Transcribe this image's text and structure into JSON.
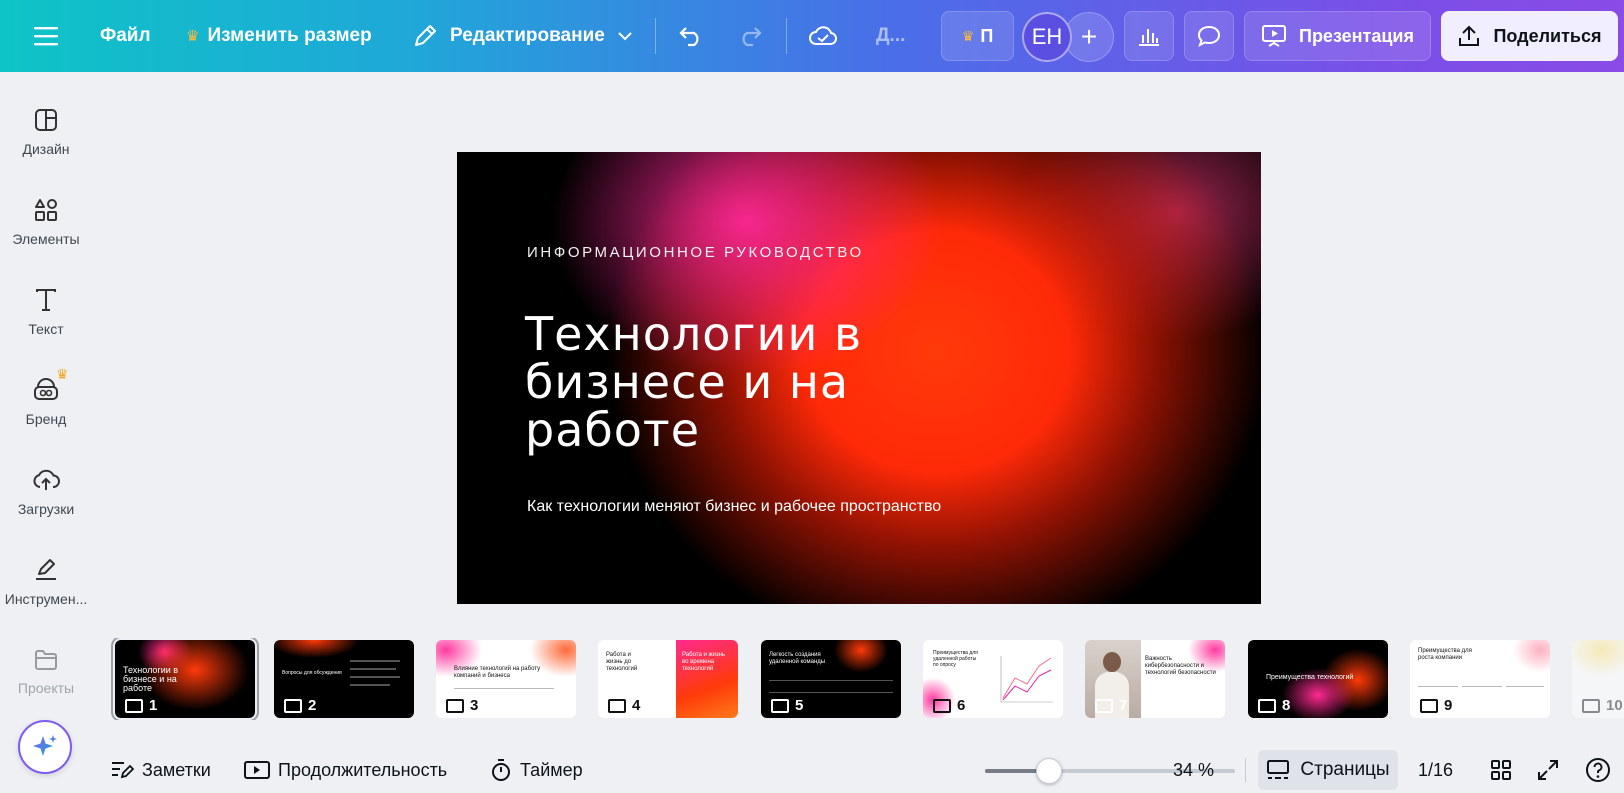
{
  "topbar": {
    "file": "Файл",
    "resize": "Изменить размер",
    "edit_mode": "Редактирование",
    "title_trunc": "Д...",
    "pro_letter": "П",
    "avatar_initials": "ЕН",
    "present": "Презентация",
    "share": "Поделиться",
    "accent_gradient": [
      "#0ec4c6",
      "#4a6ee8",
      "#8a4be6"
    ]
  },
  "sidebar": {
    "items": [
      {
        "label": "Дизайн",
        "icon": "layout-icon"
      },
      {
        "label": "Элементы",
        "icon": "shapes-icon"
      },
      {
        "label": "Текст",
        "icon": "text-icon"
      },
      {
        "label": "Бренд",
        "icon": "brand-icon"
      },
      {
        "label": "Загрузки",
        "icon": "upload-cloud-icon"
      },
      {
        "label": "Инструмен...",
        "icon": "pen-tool-icon"
      },
      {
        "label": "Проекты",
        "icon": "folder-icon"
      }
    ]
  },
  "slide": {
    "overline": "ИНФОРМАЦИОННОЕ РУКОВОДСТВО",
    "title_line1": "Технологии в",
    "title_line2": "бизнесе и на",
    "title_line3": "работе",
    "subtitle": "Как технологии меняют бизнес и рабочее пространство"
  },
  "thumbnails": [
    {
      "num": "1",
      "title": "Технологии в бизнесе и на работе"
    },
    {
      "num": "2",
      "title": "Вопросы для обсуждения"
    },
    {
      "num": "3",
      "title": "Влияние технологий на работу компаний и бизнеса"
    },
    {
      "num": "4",
      "title": "Работа и жизнь до технологий"
    },
    {
      "num": "5",
      "title": "Легкость создания удаленной команды"
    },
    {
      "num": "6",
      "title": "Преимущества для удаленной работы по опросу"
    },
    {
      "num": "7",
      "title": "Важность кибербезопасности и технологий безопасности"
    },
    {
      "num": "8",
      "title": "Преимущества технологий"
    },
    {
      "num": "9",
      "title": "Преимущества для роста компании"
    },
    {
      "num": "10",
      "title": ""
    }
  ],
  "thumb_extra": {
    "t4_right": "Работа и жизнь во времена технологий"
  },
  "bottombar": {
    "notes": "Заметки",
    "duration": "Продолжительность",
    "timer": "Таймер",
    "zoom_percent": 34,
    "zoom": "34 %",
    "pages": "Страницы",
    "page_counter": "1/16"
  }
}
